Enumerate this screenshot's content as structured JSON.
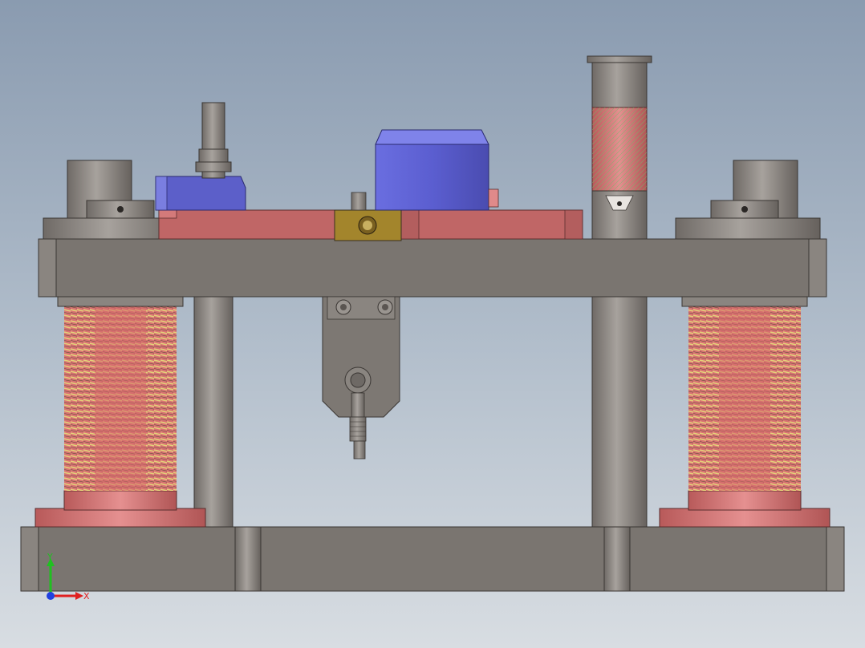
{
  "viewport": {
    "background_top": "#8a9bb0",
    "background_bottom": "#d8dde2"
  },
  "colors": {
    "steel": "#7d7873",
    "steel_dark": "#5e5955",
    "steel_light": "#9a9590",
    "plate": "#7a7570",
    "pink": "#c96d6d",
    "pink_light": "#e08a8a",
    "blue": "#5c5fc9",
    "bronze": "#a3852c",
    "spring_yellow": "#d9d27a",
    "spring_red": "#d46a6a"
  },
  "triad": {
    "x_label": "X",
    "y_label": "Y",
    "x_color": "#e02020",
    "y_color": "#20c020",
    "z_color": "#2040e0"
  }
}
